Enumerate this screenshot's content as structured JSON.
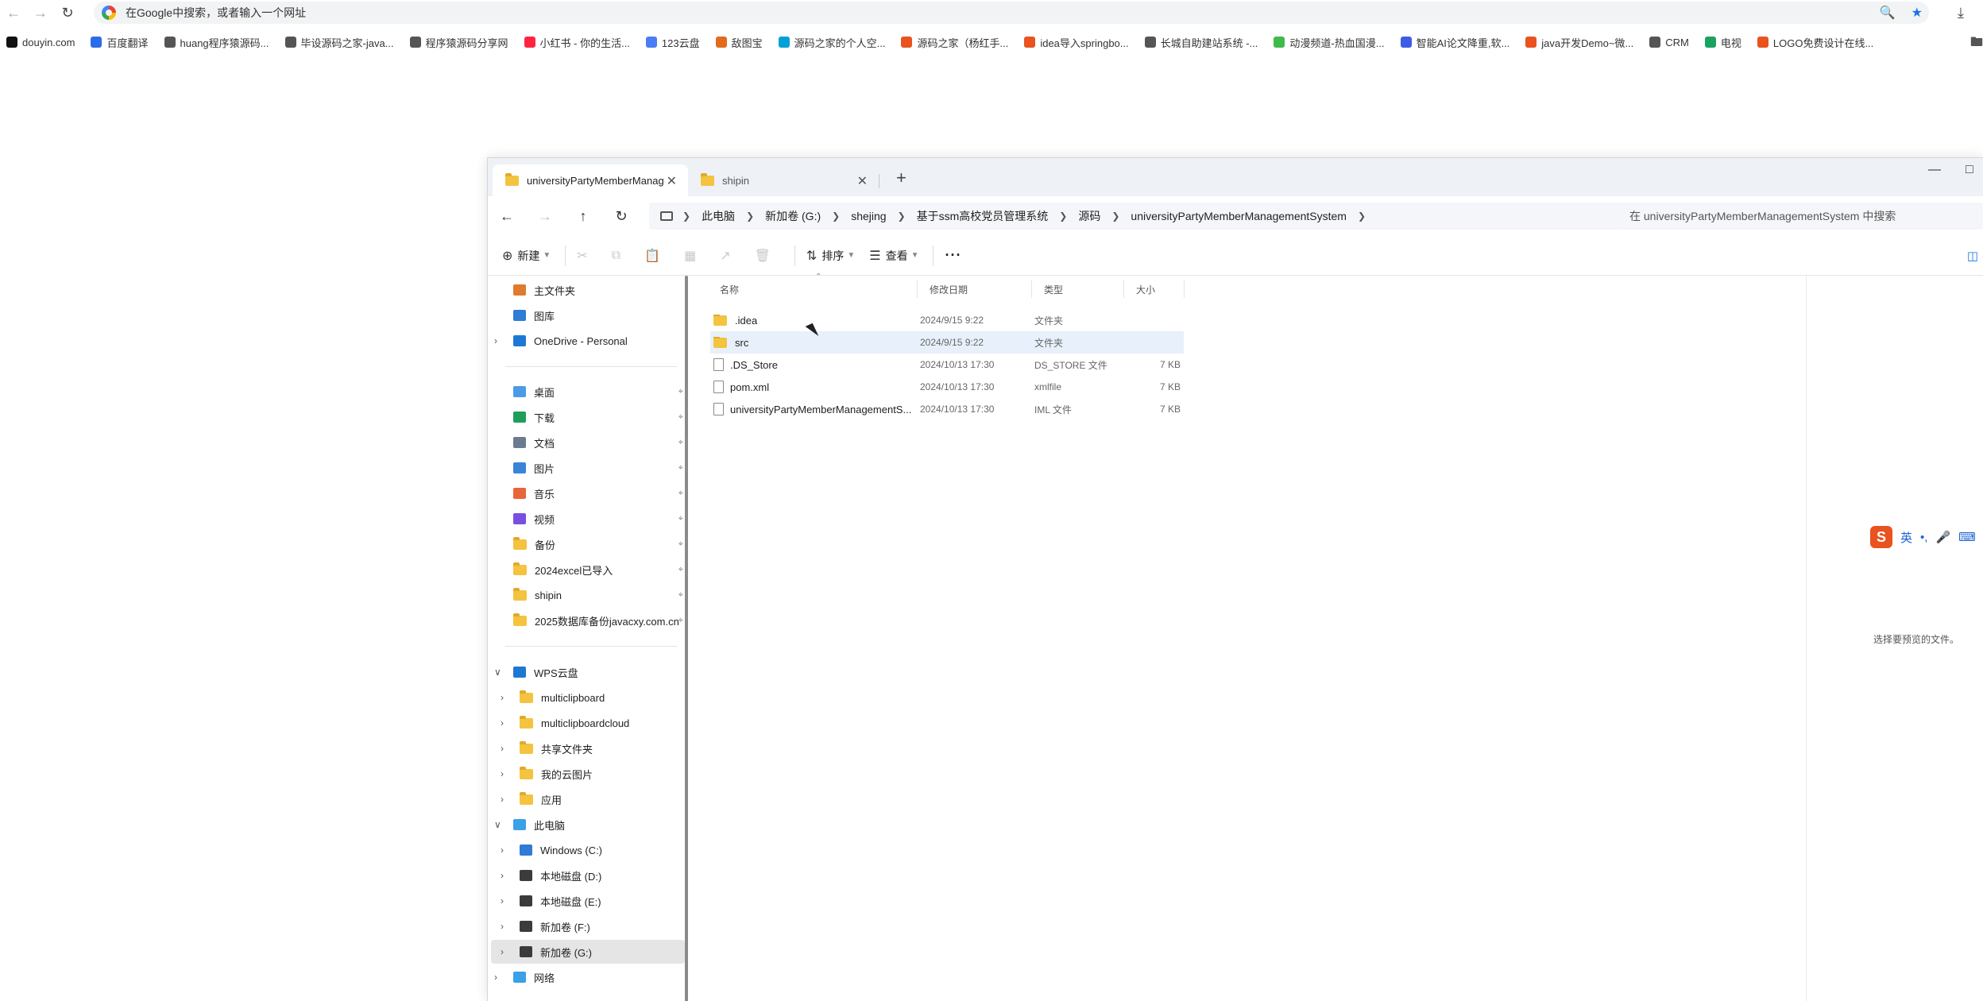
{
  "browser": {
    "omnibox_placeholder": "在Google中搜索，或者输入一个网址",
    "bookmarks": [
      {
        "label": "douyin.com",
        "color": "#111111"
      },
      {
        "label": "百度翻译",
        "color": "#2b6de8"
      },
      {
        "label": "huang程序猿源码...",
        "color": "#555555"
      },
      {
        "label": "毕设源码之家-java...",
        "color": "#555555"
      },
      {
        "label": "程序猿源码分享网",
        "color": "#555555"
      },
      {
        "label": "小红书 - 你的生活...",
        "color": "#ff2442"
      },
      {
        "label": "123云盘",
        "color": "#4a7cf6"
      },
      {
        "label": "敌图宝",
        "color": "#e26b1d"
      },
      {
        "label": "源码之家的个人空...",
        "color": "#00a1d6"
      },
      {
        "label": "源码之家（杨红手...",
        "color": "#e8531f"
      },
      {
        "label": "idea导入springbo...",
        "color": "#e8531f"
      },
      {
        "label": "长城自助建站系统 -...",
        "color": "#555555"
      },
      {
        "label": "动漫频道-热血国漫...",
        "color": "#3fba4b"
      },
      {
        "label": "智能AI论文降重,软...",
        "color": "#3c5ce6"
      },
      {
        "label": "java开发Demo~微...",
        "color": "#e8531f"
      },
      {
        "label": "CRM",
        "color": "#555555"
      },
      {
        "label": "电视",
        "color": "#1aa260"
      },
      {
        "label": "LOGO免费设计在线...",
        "color": "#e8531f"
      }
    ]
  },
  "explorer": {
    "tabs": [
      {
        "label": "universityPartyMemberManag",
        "active": true
      },
      {
        "label": "shipin",
        "active": false
      }
    ],
    "breadcrumb": [
      "此电脑",
      "新加卷 (G:)",
      "shejing",
      "基于ssm高校党员管理系统",
      "源码",
      "universityPartyMemberManagementSystem"
    ],
    "search_placeholder": "在 universityPartyMemberManagementSystem 中搜索",
    "toolbar": {
      "new_label": "新建",
      "sort_label": "排序",
      "view_label": "查看",
      "more_label": "···"
    },
    "nav": {
      "quick": [
        {
          "label": "主文件夹",
          "icon": "home-icon",
          "color": "#e07a2e"
        },
        {
          "label": "图库",
          "icon": "gallery-icon",
          "color": "#2f7bd6"
        },
        {
          "label": "OneDrive - Personal",
          "icon": "cloud-icon",
          "color": "#1f77d4"
        }
      ],
      "pinned": [
        {
          "label": "桌面",
          "icon": "desktop-icon",
          "color": "#4b9be6"
        },
        {
          "label": "下载",
          "icon": "download-icon",
          "color": "#1e9e5a"
        },
        {
          "label": "文档",
          "icon": "document-icon",
          "color": "#6d7b8f"
        },
        {
          "label": "图片",
          "icon": "pictures-icon",
          "color": "#3a84d8"
        },
        {
          "label": "音乐",
          "icon": "music-icon",
          "color": "#e8663b"
        },
        {
          "label": "视频",
          "icon": "video-icon",
          "color": "#7a4ee0"
        },
        {
          "label": "备份",
          "icon": "folder-icon",
          "color": "#f4c33f"
        },
        {
          "label": "2024excel已导入",
          "icon": "folder-icon",
          "color": "#f4c33f"
        },
        {
          "label": "shipin",
          "icon": "folder-icon",
          "color": "#f4c33f"
        },
        {
          "label": "2025数据库备份javacxy.com.cn",
          "icon": "folder-icon",
          "color": "#f4c33f"
        }
      ],
      "wps_root": "WPS云盘",
      "wps": [
        {
          "label": "multiclipboard"
        },
        {
          "label": "multiclipboardcloud"
        },
        {
          "label": "共享文件夹"
        },
        {
          "label": "我的云图片"
        },
        {
          "label": "应用"
        }
      ],
      "pc_root": "此电脑",
      "drives": [
        {
          "label": "Windows (C:)",
          "icon": "windows-drive-icon"
        },
        {
          "label": "本地磁盘 (D:)",
          "icon": "drive-icon"
        },
        {
          "label": "本地磁盘 (E:)",
          "icon": "drive-icon"
        },
        {
          "label": "新加卷 (F:)",
          "icon": "drive-icon"
        },
        {
          "label": "新加卷 (G:)",
          "icon": "drive-icon",
          "selected": true
        }
      ],
      "network": "网络"
    },
    "columns": {
      "name": "名称",
      "date": "修改日期",
      "type": "类型",
      "size": "大小"
    },
    "files": [
      {
        "name": ".idea",
        "date": "2024/9/15 9:22",
        "type": "文件夹",
        "size": "",
        "kind": "folder"
      },
      {
        "name": "src",
        "date": "2024/9/15 9:22",
        "type": "文件夹",
        "size": "",
        "kind": "folder",
        "hover": true
      },
      {
        "name": ".DS_Store",
        "date": "2024/10/13 17:30",
        "type": "DS_STORE 文件",
        "size": "7 KB",
        "kind": "file"
      },
      {
        "name": "pom.xml",
        "date": "2024/10/13 17:30",
        "type": "xmlfile",
        "size": "7 KB",
        "kind": "file"
      },
      {
        "name": "universityPartyMemberManagementS...",
        "date": "2024/10/13 17:30",
        "type": "IML 文件",
        "size": "7 KB",
        "kind": "file"
      }
    ],
    "preview_text": "选择要预览的文件。"
  },
  "ime": {
    "logo": "S",
    "mode": "英"
  }
}
